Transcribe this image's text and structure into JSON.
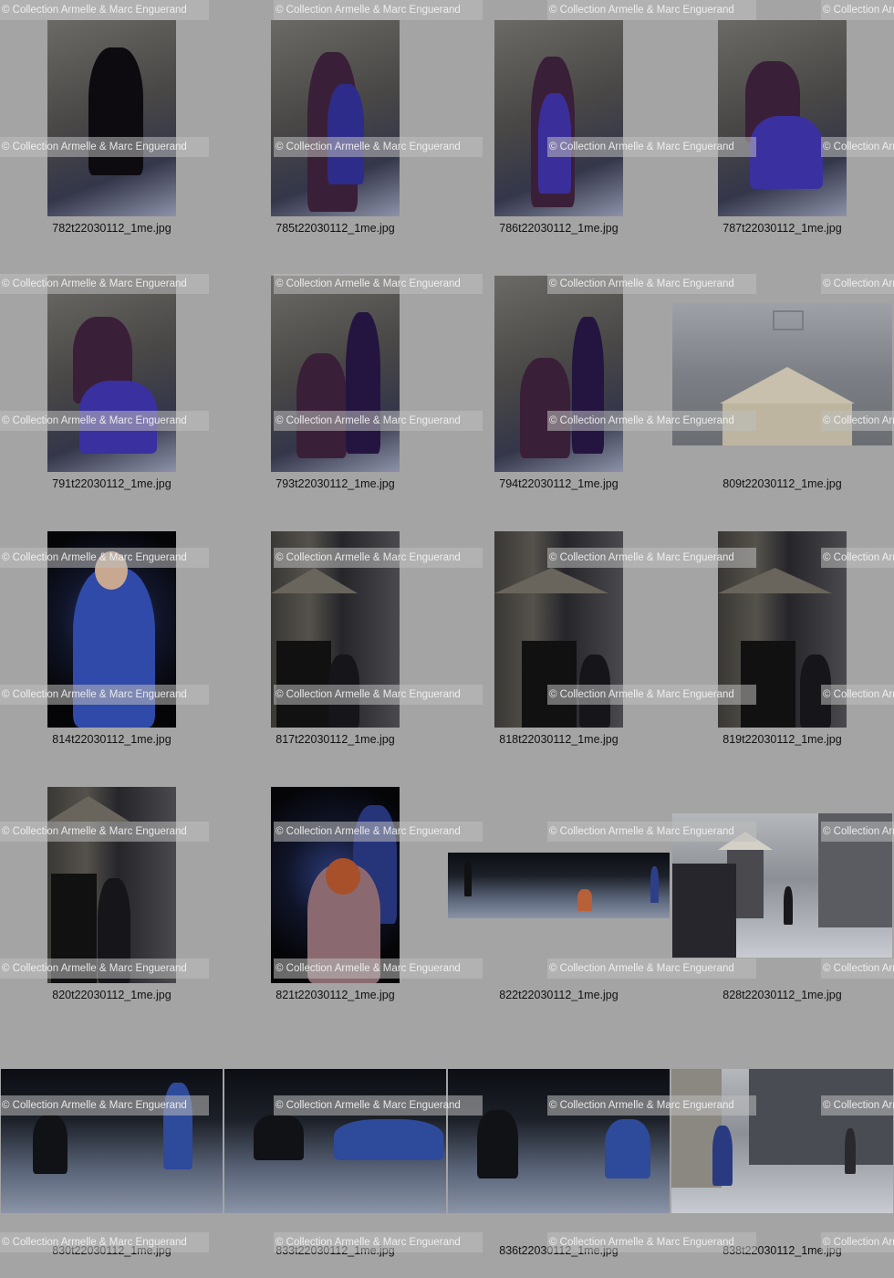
{
  "watermark": "© Collection Armelle & Marc Enguerand",
  "photos": [
    {
      "filename": "782t22030112_1me.jpg"
    },
    {
      "filename": "785t22030112_1me.jpg"
    },
    {
      "filename": "786t22030112_1me.jpg"
    },
    {
      "filename": "787t22030112_1me.jpg"
    },
    {
      "filename": "791t22030112_1me.jpg"
    },
    {
      "filename": "793t22030112_1me.jpg"
    },
    {
      "filename": "794t22030112_1me.jpg"
    },
    {
      "filename": "809t22030112_1me.jpg"
    },
    {
      "filename": "814t22030112_1me.jpg"
    },
    {
      "filename": "817t22030112_1me.jpg"
    },
    {
      "filename": "818t22030112_1me.jpg"
    },
    {
      "filename": "819t22030112_1me.jpg"
    },
    {
      "filename": "820t22030112_1me.jpg"
    },
    {
      "filename": "821t22030112_1me.jpg"
    },
    {
      "filename": "822t22030112_1me.jpg"
    },
    {
      "filename": "828t22030112_1me.jpg"
    },
    {
      "filename": "830t22030112_1me.jpg"
    },
    {
      "filename": "833t22030112_1me.jpg"
    },
    {
      "filename": "836t22030112_1me.jpg"
    },
    {
      "filename": "838t22030112_1me.jpg"
    }
  ]
}
